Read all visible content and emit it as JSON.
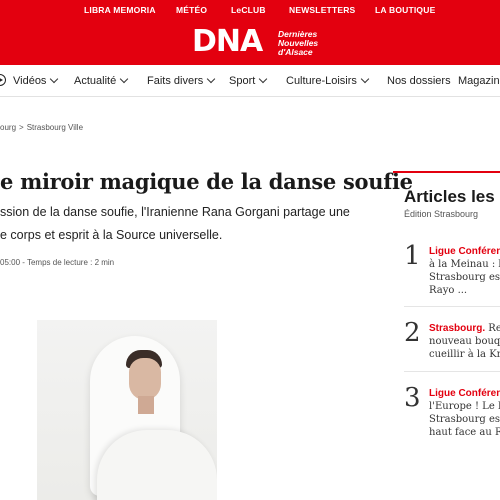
{
  "top_bar": {
    "links": [
      "LIBRA MEMORIA",
      "MÉTÉO",
      "LeCLUB",
      "NEWSLETTERS",
      "LA BOUTIQUE"
    ]
  },
  "logo": {
    "mark": "DNA",
    "sub_lines": [
      "Dernières",
      "Nouvelles",
      "d'Alsace"
    ]
  },
  "nav": {
    "items": [
      {
        "label": "Vidéos",
        "has_dropdown": true
      },
      {
        "label": "Actualité",
        "has_dropdown": true
      },
      {
        "label": "Faits divers",
        "has_dropdown": true
      },
      {
        "label": "Sport",
        "has_dropdown": true
      },
      {
        "label": "Culture-Loisirs",
        "has_dropdown": true
      },
      {
        "label": "Nos dossiers",
        "has_dropdown": false
      },
      {
        "label": "Magazine",
        "has_dropdown": false
      }
    ]
  },
  "breadcrumb": {
    "items": [
      "ourg",
      "Strasbourg Ville"
    ],
    "separator": ">"
  },
  "article": {
    "title": "e miroir magique de la danse soufie",
    "lead_lines": [
      "ssion de la danse soufie, l'Iranienne Rana Gorgani partage une",
      "e corps et esprit à la Source universelle."
    ],
    "meta": "05:00 - Temps de lecture : 2 min"
  },
  "sidebar": {
    "title": "Articles les",
    "subtitle": "Édition Strasbourg",
    "items": [
      {
        "rank": "1",
        "kicker": "Ligue Conféren",
        "lines": [
          "à la Meinau : le",
          "Strasbourg est",
          "Rayo ..."
        ]
      },
      {
        "rank": "2",
        "kicker": "Strasbourg.",
        "first_rest": " Re",
        "lines": [
          "nouveau bouqu",
          "cueillir à la Kru"
        ]
      },
      {
        "rank": "3",
        "kicker": "Ligue Conféren",
        "lines": [
          "l'Europe ! Le Ra",
          "Strasbourg est",
          "haut face au Ra"
        ]
      }
    ]
  },
  "colors": {
    "brand_red": "#e3000f"
  }
}
